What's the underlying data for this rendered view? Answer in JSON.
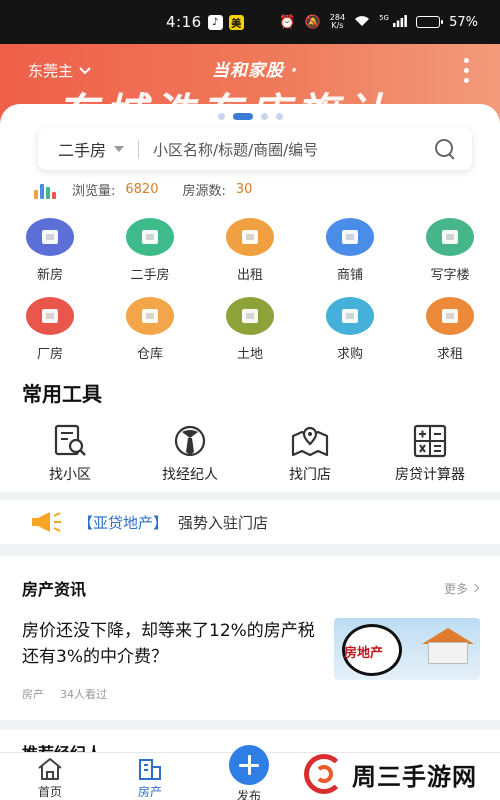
{
  "status_bar": {
    "time": "4:16",
    "net_speed_value": "284",
    "net_speed_unit": "K/s",
    "signal_tag": "5G",
    "battery": "57%",
    "battery_level": 0.57
  },
  "banner": {
    "city": "东莞主",
    "slogan": "当和家股 ·",
    "headline": "东城浩东店旗计"
  },
  "carousel": {
    "count": 4,
    "active_index": 1
  },
  "search": {
    "type": "二手房",
    "placeholder": "小区名称/标题/商圈/编号"
  },
  "stats": {
    "views_label": "浏览量:",
    "views_value": "6820",
    "listings_label": "房源数:",
    "listings_value": "30"
  },
  "categories": [
    {
      "label": "新房",
      "icon": "building-icon",
      "color": "#5b6fd6"
    },
    {
      "label": "二手房",
      "icon": "house-icon",
      "color": "#3dbb8a"
    },
    {
      "label": "出租",
      "icon": "rent-icon",
      "color": "#f0a040"
    },
    {
      "label": "商铺",
      "icon": "shop-icon",
      "color": "#4a8de8"
    },
    {
      "label": "写字楼",
      "icon": "office-icon",
      "color": "#46b58a"
    },
    {
      "label": "厂房",
      "icon": "factory-icon",
      "color": "#e9574c"
    },
    {
      "label": "仓库",
      "icon": "warehouse-icon",
      "color": "#f2a649"
    },
    {
      "label": "土地",
      "icon": "land-icon",
      "color": "#8ea23a"
    },
    {
      "label": "求购",
      "icon": "buy-request-icon",
      "color": "#45b0d8"
    },
    {
      "label": "求租",
      "icon": "rent-request-icon",
      "color": "#ed8a3a"
    }
  ],
  "tools": {
    "title": "常用工具",
    "items": [
      {
        "label": "找小区",
        "icon": "find-community-icon"
      },
      {
        "label": "找经纪人",
        "icon": "find-agent-icon"
      },
      {
        "label": "找门店",
        "icon": "find-store-icon"
      },
      {
        "label": "房贷计算器",
        "icon": "mortgage-calculator-icon"
      }
    ]
  },
  "notice": {
    "tag": "【亚贷地产】",
    "text": "强势入驻门店"
  },
  "news": {
    "title": "房产资讯",
    "more": "更多",
    "article": {
      "title": "房价还没下降，却等来了12%的房产税还有3%的中介费？",
      "category": "房产",
      "views": "34人看过",
      "thumb_text": "房地产"
    }
  },
  "next_section_title": "推荐经纪人",
  "tabbar": {
    "home": "首页",
    "house": "房产",
    "post": "发布"
  },
  "watermark": "周三手游网",
  "colors": {
    "primary": "#2f6fc9",
    "banner": "#ef5f4a",
    "stat_number": "#d4802a",
    "notice_icon": "#f5a623"
  }
}
